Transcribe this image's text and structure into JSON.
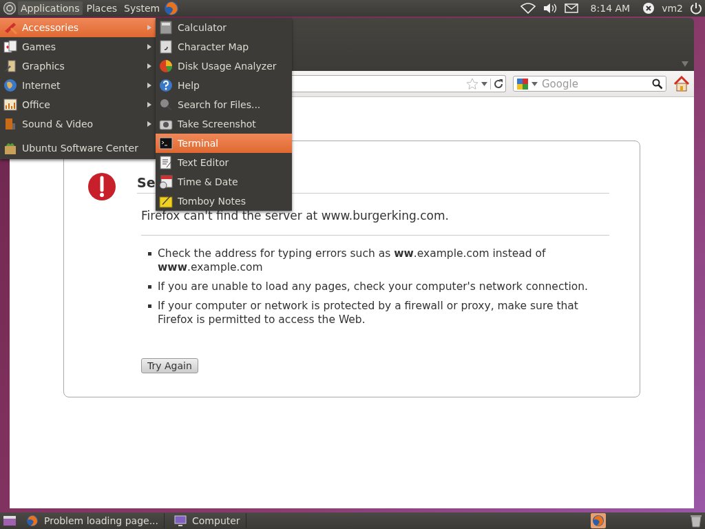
{
  "top_panel": {
    "menus": [
      {
        "label": "Applications",
        "selected": true
      },
      {
        "label": "Places",
        "selected": false
      },
      {
        "label": "System",
        "selected": false
      }
    ],
    "clock": "8:14 AM",
    "user": "vm2"
  },
  "applications_menu": {
    "items": [
      {
        "label": "Accessories",
        "kind": "category",
        "selected": true
      },
      {
        "label": "Games",
        "kind": "category",
        "selected": false
      },
      {
        "label": "Graphics",
        "kind": "category",
        "selected": false
      },
      {
        "label": "Internet",
        "kind": "category",
        "selected": false
      },
      {
        "label": "Office",
        "kind": "category",
        "selected": false
      },
      {
        "label": "Sound & Video",
        "kind": "category",
        "selected": false
      },
      {
        "label": "Ubuntu Software Center",
        "kind": "app",
        "selected": false
      }
    ]
  },
  "accessories_menu": {
    "items": [
      {
        "label": "Calculator",
        "selected": false
      },
      {
        "label": "Character Map",
        "selected": false
      },
      {
        "label": "Disk Usage Analyzer",
        "selected": false
      },
      {
        "label": "Help",
        "selected": false
      },
      {
        "label": "Search for Files...",
        "selected": false
      },
      {
        "label": "Take Screenshot",
        "selected": false
      },
      {
        "label": "Terminal",
        "selected": true
      },
      {
        "label": "Text Editor",
        "selected": false
      },
      {
        "label": "Time & Date",
        "selected": false
      },
      {
        "label": "Tomboy Notes",
        "selected": false
      }
    ]
  },
  "browser": {
    "search": {
      "placeholder": "Google"
    },
    "error_page": {
      "heading": "Se",
      "message": "Firefox can't find the server at www.burgerking.com.",
      "bullets": [
        "Check the address for typing errors such as **ww**.example.com instead of **www**.example.com",
        "If you are unable to load any pages, check your computer's network connection.",
        "If your computer or network is protected by a firewall or proxy, make sure that Firefox is permitted to access the Web."
      ],
      "button": "Try Again"
    }
  },
  "taskbar": {
    "windows": [
      {
        "label": "Problem loading page...",
        "selected": false
      },
      {
        "label": "Computer",
        "selected": false
      }
    ]
  }
}
